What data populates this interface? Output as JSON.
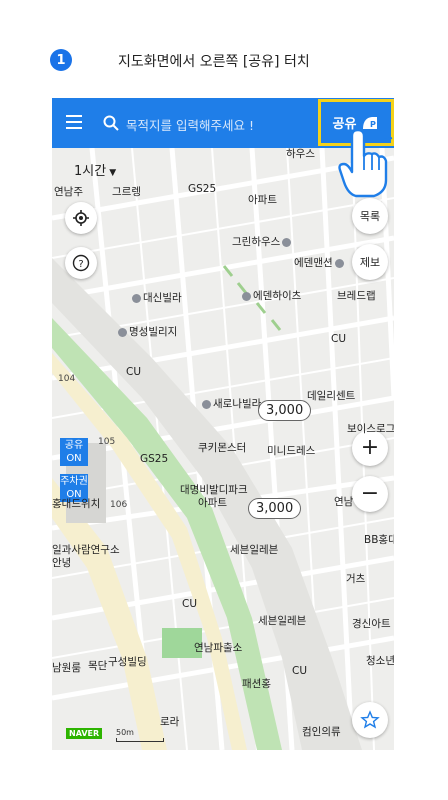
{
  "step": {
    "number": "1",
    "text": "지도화면에서 오른쪽 [공유] 터치"
  },
  "topbar": {
    "search_placeholder": "목적지를 입력해주세요 !",
    "share_label": "공유"
  },
  "time_filter": {
    "value": "1시간"
  },
  "side_buttons": {
    "list": "목록",
    "report": "제보",
    "zoom_in": "+",
    "zoom_out": "−"
  },
  "badges": {
    "share": [
      "공유",
      "ON"
    ],
    "parking": [
      "주차권",
      "ON"
    ]
  },
  "price_tags": [
    "3,000",
    "3,000"
  ],
  "map_labels": {
    "grinhouse": "그린하우스",
    "edenmansion": "에덴맨션",
    "breadandrep": "브레드랩",
    "daesin": "대신빌라",
    "edenheights": "에덴하이츠",
    "myungsung": "명성빌리지",
    "cu1": "CU",
    "cu2": "CU",
    "cu3": "CU",
    "cu4": "CU",
    "saenaru": "새로나빌라",
    "dailycenter": "데일리센트",
    "boisro": "보이스로그",
    "kukimonster": "쿠키몬스터",
    "minidress": "미니드레스",
    "gs25_1": "GS25",
    "gs25_2": "GS25",
    "daemyung": "대명비발디파크",
    "apt": "아파트",
    "apt2": "아파트",
    "yeonhee": "연남",
    "seven1": "세븐일레븐",
    "seven2": "세븐일레븐",
    "bbhong": "BB홍대",
    "geoch": "거츠",
    "ilgwa": "일과사람연구소",
    "anyeong": "안녕",
    "gyeongsin": "경신아트",
    "cheongsonal": "청소년",
    "yeonnam_police": "연남파출소",
    "gusung": "구성빌딩",
    "mokdan": "목단",
    "namwonroo": "남원룸",
    "paesun": "패션홍",
    "lora": "로라",
    "keomineuiyu": "컴인의류",
    "hongdae_switch": "홍대드위치",
    "yuhoo": "하우스",
    "yeonbit": "연남주",
    "gusyeol": "그르렝",
    "label_104": "104",
    "label_105": "105",
    "label_106": "106"
  },
  "scale": {
    "text": "50m",
    "brand": "NAVER"
  }
}
